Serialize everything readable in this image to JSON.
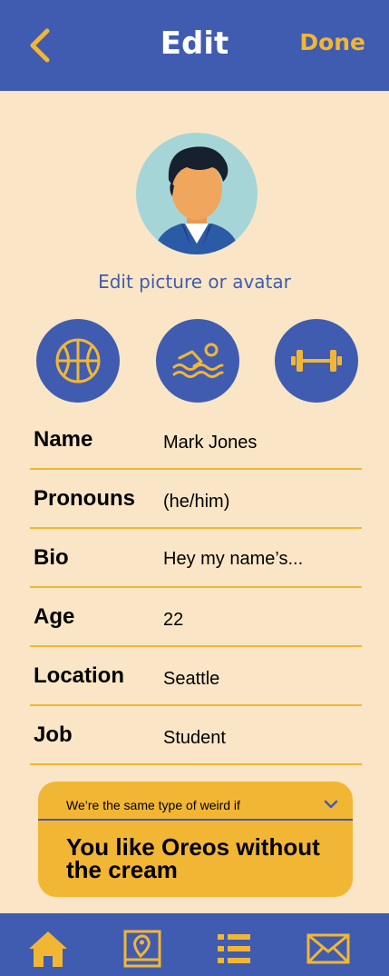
{
  "header": {
    "title": "Edit",
    "done_label": "Done",
    "back_icon": "chevron-left-icon"
  },
  "profile": {
    "avatar_icon": "avatar-icon",
    "edit_picture_label": "Edit picture or avatar"
  },
  "interests": [
    {
      "icon": "basketball-icon"
    },
    {
      "icon": "swimming-icon"
    },
    {
      "icon": "dumbbell-icon"
    }
  ],
  "fields": {
    "name": {
      "label": "Name",
      "value": "Mark Jones"
    },
    "pronouns": {
      "label": "Pronouns",
      "value": "(he/him)"
    },
    "bio": {
      "label": "Bio",
      "value": "Hey my name’s..."
    },
    "age": {
      "label": "Age",
      "value": "22"
    },
    "location": {
      "label": "Location",
      "value": "Seattle"
    },
    "job": {
      "label": "Job",
      "value": "Student"
    }
  },
  "prompt": {
    "question": "We’re the same type of weird if",
    "answer": "You like Oreos without the cream",
    "chevron_icon": "chevron-down-icon"
  },
  "tabbar": [
    {
      "icon": "home-icon",
      "active": true
    },
    {
      "icon": "map-pin-icon",
      "active": false
    },
    {
      "icon": "list-icon",
      "active": false
    },
    {
      "icon": "mail-icon",
      "active": false
    }
  ],
  "colors": {
    "primary": "#405cb0",
    "accent": "#f2b635",
    "background": "#fae6c6",
    "avatar_bg": "#a6d5d8"
  }
}
